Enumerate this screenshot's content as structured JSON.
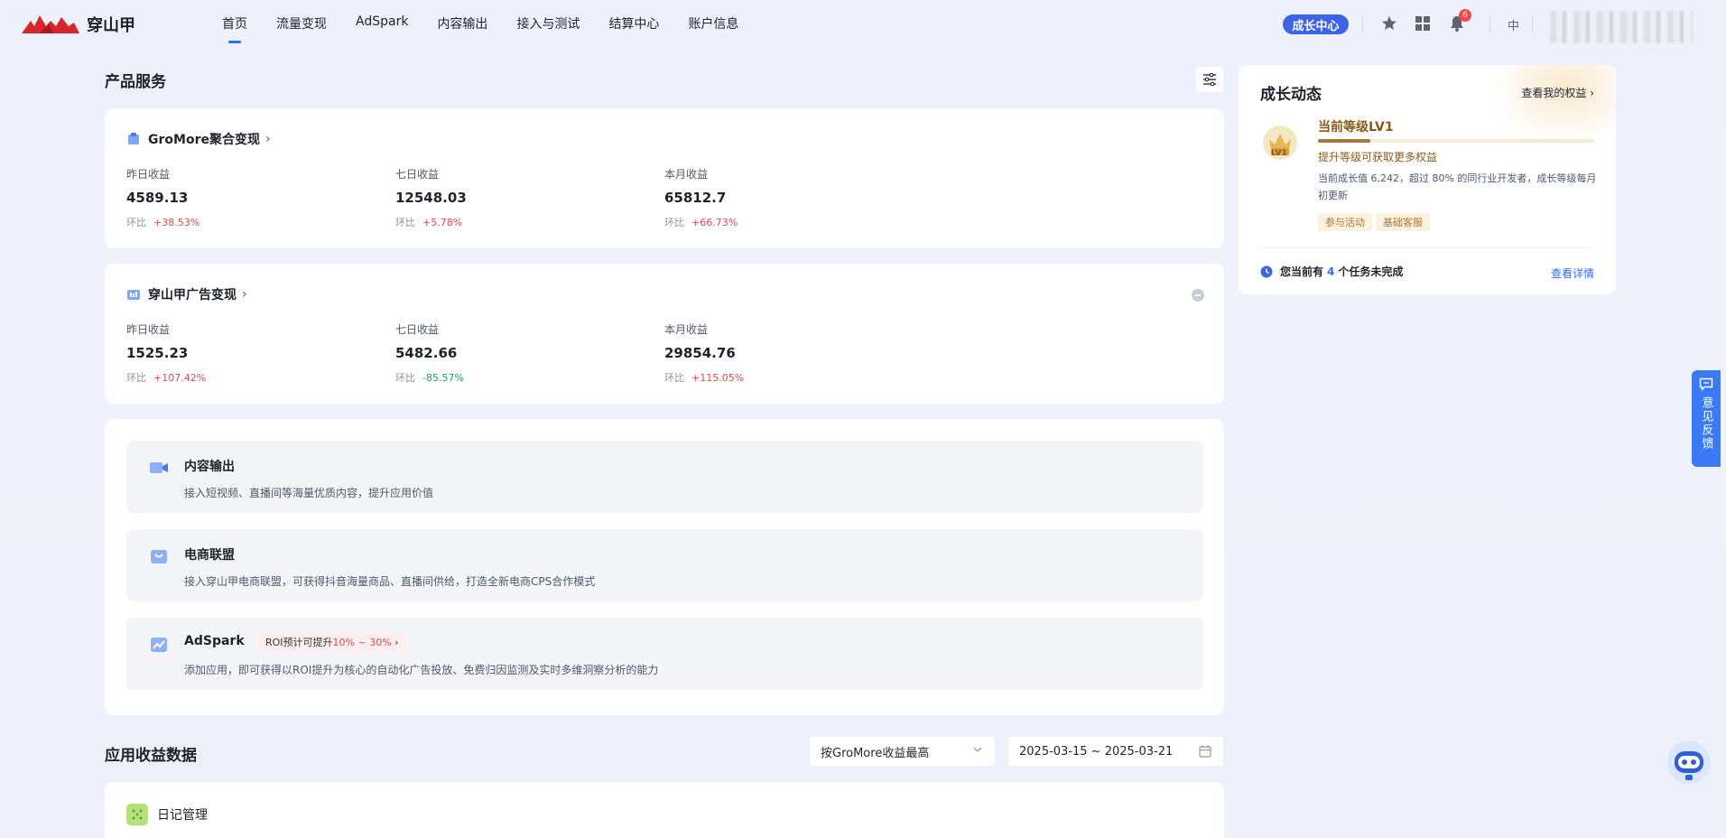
{
  "header": {
    "brand": "穿山甲",
    "nav": [
      "首页",
      "流量变现",
      "AdSpark",
      "内容输出",
      "接入与测试",
      "结算中心",
      "账户信息"
    ],
    "active_nav": 0,
    "growth_center": "成长中心",
    "bell_badge": "6",
    "lang": "中"
  },
  "product_services": {
    "title": "产品服务",
    "products": [
      {
        "name": "GroMore聚合变现",
        "metrics": [
          {
            "label": "昨日收益",
            "value": "4589.13",
            "cmp_label": "环比",
            "cmp": "+38.53%",
            "trend": "up"
          },
          {
            "label": "七日收益",
            "value": "12548.03",
            "cmp_label": "环比",
            "cmp": "+5.78%",
            "trend": "up"
          },
          {
            "label": "本月收益",
            "value": "65812.7",
            "cmp_label": "环比",
            "cmp": "+66.73%",
            "trend": "up"
          }
        ]
      },
      {
        "name": "穿山甲广告变现",
        "metrics": [
          {
            "label": "昨日收益",
            "value": "1525.23",
            "cmp_label": "环比",
            "cmp": "+107.42%",
            "trend": "up"
          },
          {
            "label": "七日收益",
            "value": "5482.66",
            "cmp_label": "环比",
            "cmp": "-85.57%",
            "trend": "down"
          },
          {
            "label": "本月收益",
            "value": "29854.76",
            "cmp_label": "环比",
            "cmp": "+115.05%",
            "trend": "up"
          }
        ]
      }
    ],
    "features": [
      {
        "title": "内容输出",
        "desc": "接入短视频、直播间等海量优质内容，提升应用价值"
      },
      {
        "title": "电商联盟",
        "desc": "接入穿山甲电商联盟，可获得抖音海量商品、直播间供给，打造全新电商CPS合作模式"
      },
      {
        "title": "AdSpark",
        "desc": "添加应用，即可获得以ROI提升为核心的自动化广告投放、免费归因监测及实时多维洞察分析的能力",
        "tag_prefix": "ROI预计可提升",
        "tag_highlight": "10% ~ 30%",
        "tag_suffix": "›"
      }
    ]
  },
  "growth": {
    "title": "成长动态",
    "link": "查看我的权益 ›",
    "badge": "LV1",
    "level": "当前等级LV1",
    "level_progress": 0.19,
    "sub": "提升等级可获取更多权益",
    "desc": "当前成长值 6,242，超过 80% 的同行业开发者，成长等级每月初更新",
    "tags": [
      "参与活动",
      "基础客服"
    ],
    "task_prefix": "您当前有",
    "task_count": "4",
    "task_suffix": "个任务未完成",
    "task_link": "查看详情"
  },
  "feedback": {
    "label": "意见反馈"
  },
  "app_revenue": {
    "title": "应用收益数据",
    "sort_select": "按GroMore收益最高",
    "date_range": "2025-03-15 ~ 2025-03-21",
    "apps": [
      {
        "name": "日记管理"
      }
    ]
  },
  "colors": {
    "accent": "#2f6bff",
    "up": "#e0494e",
    "down": "#1aa36a",
    "gold": "#a8773d"
  }
}
